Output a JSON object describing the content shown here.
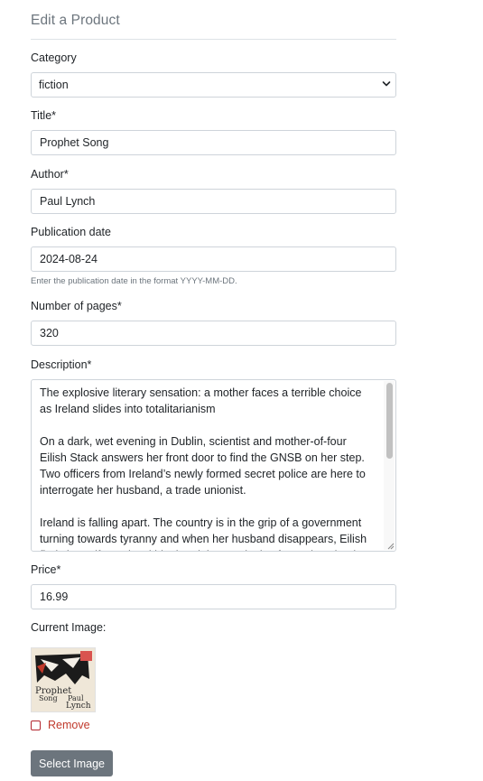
{
  "page": {
    "title": "Edit a Product"
  },
  "form": {
    "category": {
      "label": "Category",
      "value": "fiction"
    },
    "title": {
      "label": "Title*",
      "value": "Prophet Song"
    },
    "author": {
      "label": "Author*",
      "value": "Paul Lynch"
    },
    "publication_date": {
      "label": "Publication date",
      "value": "2024-08-24",
      "help": "Enter the publication date in the format YYYY-MM-DD."
    },
    "pages": {
      "label": "Number of pages*",
      "value": "320"
    },
    "description": {
      "label": "Description*",
      "value": "The explosive literary sensation: a mother faces a terrible choice as Ireland slides into totalitarianism\n\nOn a dark, wet evening in Dublin, scientist and mother-of-four Eilish Stack answers her front door to find the GNSB on her step. Two officers from Ireland’s newly formed secret police are here to interrogate her husband, a trade unionist.\n\nIreland is falling apart. The country is in the grip of a government turning towards tyranny and when her husband disappears, Eilish finds herself caught within the nightmare logic of a society that is"
    },
    "price": {
      "label": "Price*",
      "value": "16.99"
    },
    "current_image": {
      "label": "Current Image:",
      "cover_text": [
        "Prophet",
        "Song",
        "Paul",
        "Lynch"
      ]
    },
    "remove": {
      "label": "Remove",
      "checked": false
    },
    "select_image_button": "Select Image"
  },
  "colors": {
    "muted": "#6c757d",
    "danger": "#c0392b",
    "border": "#ced4da"
  }
}
